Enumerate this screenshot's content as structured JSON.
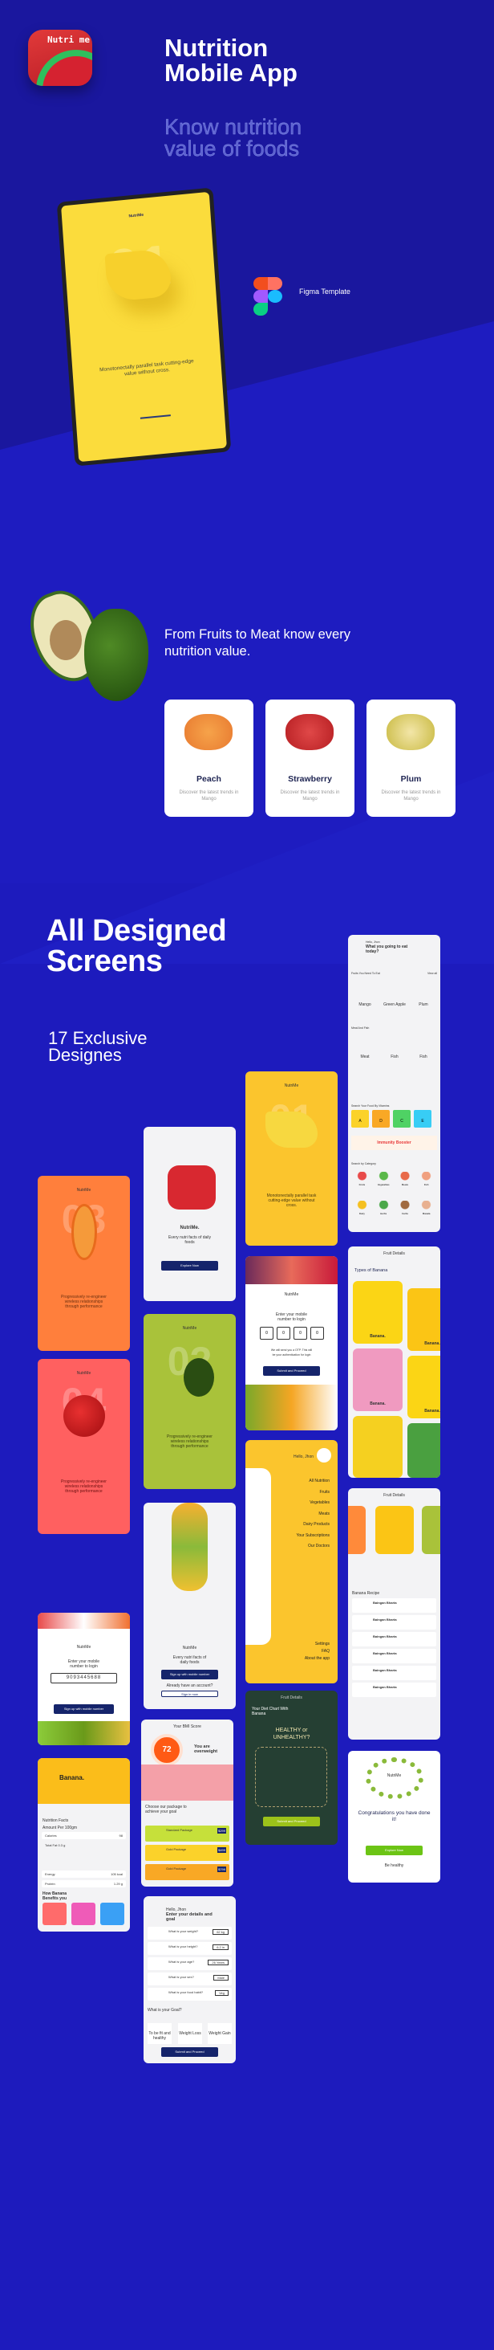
{
  "hero": {
    "app_icon_text": "Nutri me",
    "title_line1": "Nutrition",
    "title_line2": "Mobile App",
    "subtitle_line1": "Know nutrition",
    "subtitle_line2": "value of foods",
    "figma_label": "Figma Template"
  },
  "phone": {
    "brand": "NutriMe",
    "number": "01",
    "caption": "Monotonectally parallel task cutting-edge value without cross."
  },
  "features": {
    "tagline": "From Fruits to Meat know every nutrition value.",
    "cards": [
      {
        "name": "Peach",
        "desc": "Discover the latest trends in Mango"
      },
      {
        "name": "Strawberry",
        "desc": "Discover the latest trends in Mango"
      },
      {
        "name": "Plum",
        "desc": "Discover the latest trends in Mango"
      }
    ]
  },
  "screens_section": {
    "heading_line1": "All Designed",
    "heading_line2": "Screens",
    "sub_line1": "17 Exclusive",
    "sub_line2": "Designes"
  },
  "screens": {
    "brand": "NutriMe",
    "onboard_text": "Progressively re-engineer wireless relationships through performance",
    "papaya_num": "03",
    "apple_num": "04",
    "avocado_num": "02",
    "banana_num": "01",
    "banana_caption": "Monotonectally parallel task cutting-edge value without cross.",
    "splash_title": "NutriMe.",
    "splash_sub": "Every nutri facts of daily foods",
    "explore": "Explore Now",
    "otp_prompt": "Enter your mobile number to login",
    "otp_digits": [
      "0",
      "0",
      "0",
      "0"
    ],
    "otp_note": "We will send you a OTP. This will be your authentication for login",
    "submit": "Submit and Proceed",
    "home_greet": "Hello, Jhon",
    "home_title": "What you going to eat today?",
    "home_fruits": "Fruits You Need To Eat",
    "view_all": "View all",
    "home_items": [
      "Mango",
      "Green Apple",
      "Plum"
    ],
    "home_meat": "Meat And Fish",
    "home_meat_items": [
      "Meat",
      "Fish",
      "Fish"
    ],
    "vitamins_label": "Search Your Food By Vitamins",
    "vitamins": [
      "A",
      "D",
      "C",
      "E"
    ],
    "booster": "Immunity Booster",
    "category_label": "Search by Category",
    "categories": [
      "Fruits",
      "Vegetables",
      "Meats",
      "Fish",
      "Dairy",
      "Herbs",
      "Carbs",
      "Masala"
    ],
    "types_header": "Fruit Details",
    "types_title": "Types of Banana",
    "types_items": [
      "Banana.",
      "Banana.",
      "Banana.",
      "Banana."
    ],
    "menu_greet": "Hello, Jhon",
    "menu_items": [
      "All Nutrition",
      "Fruits",
      "Vegetables",
      "Meats",
      "Dairy Products",
      "Your Subscriptions",
      "Our Doctors"
    ],
    "menu_bottom": [
      "Settings",
      "FAQ",
      "About the app"
    ],
    "login_number": "9093445688",
    "signup_mobile": "Sign up with mobile number",
    "already": "Already have an account?",
    "signin": "Sign in now",
    "recipe_title": "Banana Recipe",
    "recipe_items": [
      "Baingan Bharta",
      "Baingan Bharta",
      "Baingan Bharta",
      "Baingan Bharta",
      "Baingan Bharta",
      "Baingan Bharta"
    ],
    "diet_title": "Your Diet Chart With Banana",
    "diet_art": "HEALTHY or UNHEALTHY?",
    "bmi_header": "Your BMI Score",
    "bmi_score": "72",
    "bmi_msg": "You are overweight",
    "bmi_choose": "Choose our package to achieve your goal",
    "packages": [
      {
        "name": "Standard Package",
        "price": "$299",
        "color": "#c6e03a"
      },
      {
        "name": "Gold Package",
        "price": "$499",
        "color": "#fbd22a"
      },
      {
        "name": "Gold Package",
        "price": "$799",
        "color": "#f9a825"
      }
    ],
    "congrats": "Congratulations you have done it!",
    "be_healthy": "Be healthy",
    "banana_detail_title": "Banana.",
    "nutrition_facts": "Nutrition Facts",
    "amount": "Amount Per 100gm",
    "facts": [
      [
        "Calories",
        "98"
      ],
      [
        "Total Fat 0.3 g",
        ""
      ],
      [
        "Energy",
        "105 kcal"
      ],
      [
        "Protein",
        "1.29 g"
      ]
    ],
    "benefits": "How Banana Benefits you",
    "details_greet": "Hello, Jhon",
    "details_title": "Enter your details and goal",
    "questions": [
      [
        "What is your weight?",
        "62 kg"
      ],
      [
        "What is your height?",
        "6.2 in"
      ],
      [
        "What is your age?",
        "26 Years"
      ],
      [
        "What is your sex?",
        "Male"
      ],
      [
        "What is your food habit?",
        "Veg"
      ]
    ],
    "goal_q": "What is your Goal?",
    "goals": [
      "To be fit and healthy",
      "Weight Loss",
      "Weight Gain"
    ]
  },
  "colors": {
    "bg": "#1a179e",
    "floor": "#1e1cc0",
    "navy": "#15246b",
    "yellow": "#fbc52d",
    "orange": "#ff7f3c",
    "red": "#ff5e5e",
    "green": "#a9c23a"
  }
}
